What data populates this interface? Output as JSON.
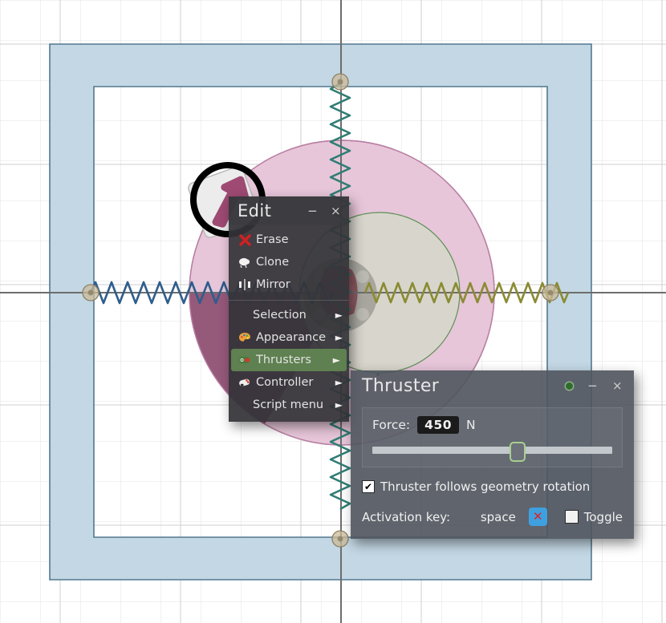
{
  "app": {
    "name": "physics-sandbox-canvas"
  },
  "canvas": {
    "grid": {
      "spacing_px": 50,
      "minor_color": "#e2e2e2",
      "major_color": "#c9c9c9"
    },
    "axis_color": "#6b6b6b",
    "bodies": [
      {
        "name": "outer-frame",
        "shape": "rect-frame",
        "fill": "#c3d7e4",
        "stroke": "#5b7f99"
      },
      {
        "name": "large-circle",
        "shape": "circle",
        "fill": "#e9c9dc",
        "stroke": "#b87fa3"
      },
      {
        "name": "dark-wedge",
        "shape": "wedge",
        "fill": "#8e4f72"
      },
      {
        "name": "inner-circle",
        "shape": "circle",
        "fill": "#cfdfc4",
        "stroke": "#5e8f58"
      },
      {
        "name": "gear-sprite",
        "shape": "gear",
        "fill": "#4a4a4a"
      }
    ],
    "springs": [
      {
        "name": "spring-left",
        "color": "#2f5d8c",
        "orientation": "horizontal"
      },
      {
        "name": "spring-right",
        "color": "#8a8b32",
        "orientation": "horizontal"
      },
      {
        "name": "spring-vertical",
        "color": "#2f7d74",
        "orientation": "vertical"
      }
    ],
    "anchors": [
      {
        "name": "anchor-left"
      },
      {
        "name": "anchor-right"
      },
      {
        "name": "anchor-top"
      },
      {
        "name": "anchor-bottom"
      }
    ],
    "thruster_marker": {
      "name": "thruster-arrow",
      "selected": true,
      "arrow_color": "#9e4a73"
    }
  },
  "edit_menu": {
    "title": "Edit",
    "minimize_label": "−",
    "close_label": "×",
    "arrow_glyph": "►",
    "items": [
      {
        "label": "Erase",
        "icon": "erase-x-icon",
        "submenu": false,
        "selected": false
      },
      {
        "label": "Clone",
        "icon": "clone-icon",
        "submenu": false,
        "selected": false
      },
      {
        "label": "Mirror",
        "icon": "mirror-icon",
        "submenu": false,
        "selected": false
      },
      {
        "label": "Selection",
        "icon": "",
        "submenu": true,
        "selected": false
      },
      {
        "label": "Appearance",
        "icon": "palette-icon",
        "submenu": true,
        "selected": false
      },
      {
        "label": "Thrusters",
        "icon": "thruster-icon",
        "submenu": true,
        "selected": true
      },
      {
        "label": "Controller",
        "icon": "gamepad-icon",
        "submenu": true,
        "selected": false
      },
      {
        "label": "Script menu",
        "icon": "",
        "submenu": true,
        "selected": false
      }
    ]
  },
  "thruster_dialog": {
    "title": "Thruster",
    "pin_label": "",
    "minimize_label": "−",
    "close_label": "×",
    "force": {
      "label": "Force:",
      "value": "450",
      "unit": "N",
      "slider_percent": 60
    },
    "follows_rotation": {
      "label": "Thruster follows geometry rotation",
      "checked": true,
      "check_glyph": "✔"
    },
    "activation": {
      "label": "Activation key:",
      "key": "space",
      "clear_glyph": "✕",
      "toggle_label": "Toggle",
      "toggle_checked": false
    }
  }
}
